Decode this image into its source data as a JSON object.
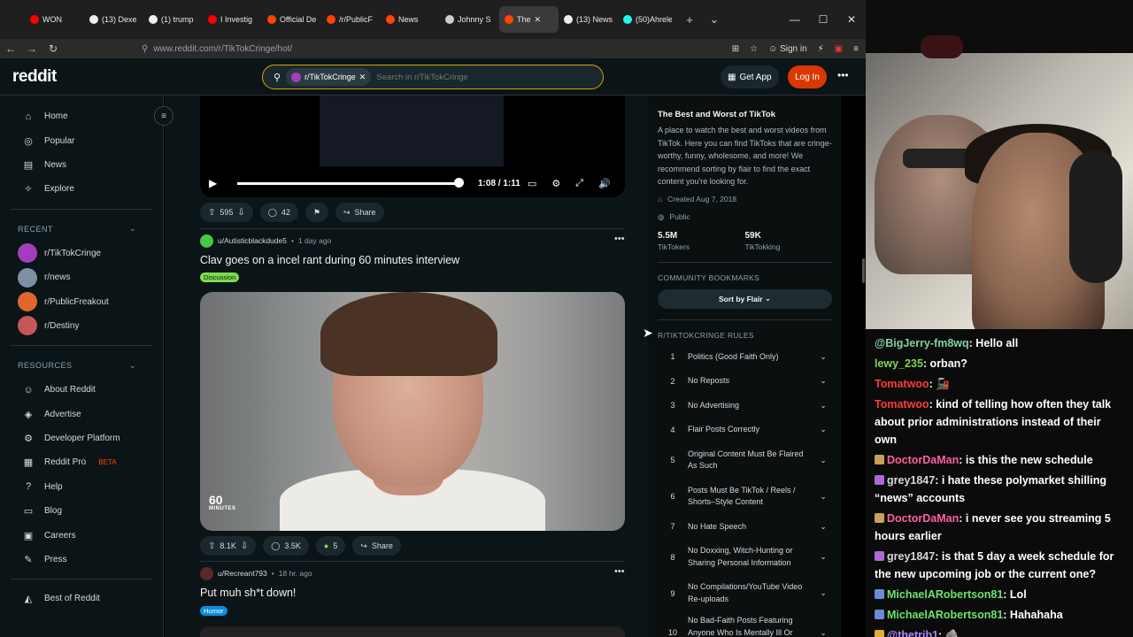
{
  "browser": {
    "tabs": [
      {
        "label": "WON",
        "color": "#ff0000"
      },
      {
        "label": "(13) Dexe",
        "color": "#eeeeee"
      },
      {
        "label": "(1) trump",
        "color": "#eeeeee"
      },
      {
        "label": "I Investig",
        "color": "#ff0000"
      },
      {
        "label": "Official De",
        "color": "#ff4500"
      },
      {
        "label": "/r/PublicF",
        "color": "#ff4500"
      },
      {
        "label": "News",
        "color": "#ff4500"
      },
      {
        "label": "Johnny S",
        "color": "#cccccc"
      },
      {
        "label": "The",
        "color": "#ff4500"
      },
      {
        "label": "(13) News",
        "color": "#eeeeee"
      },
      {
        "label": "(50)Ahrele",
        "color": "#25f4ee"
      }
    ],
    "url": "www.reddit.com/r/TikTokCringe/hot/",
    "sign_in": "Sign in"
  },
  "header": {
    "logo": "reddit",
    "search_chip": "r/TikTokCringe",
    "search_placeholder": "Search in r/TikTokCringe",
    "get_app": "Get App",
    "log_in": "Log In"
  },
  "sidebar": {
    "main_items": [
      {
        "label": "Home",
        "icon": "⌂"
      },
      {
        "label": "Popular",
        "icon": "◎"
      },
      {
        "label": "News",
        "icon": "▤"
      },
      {
        "label": "Explore",
        "icon": "✧"
      }
    ],
    "recent_label": "RECENT",
    "recent": [
      {
        "label": "r/TikTokCringe",
        "color": "#a33dbd"
      },
      {
        "label": "r/news",
        "color": "#7c8fa3"
      },
      {
        "label": "r/PublicFreakout",
        "color": "#e2662b"
      },
      {
        "label": "r/Destiny",
        "color": "#c45858"
      }
    ],
    "resources_label": "RESOURCES",
    "resources": [
      {
        "label": "About Reddit",
        "icon": "☺"
      },
      {
        "label": "Advertise",
        "icon": "◈"
      },
      {
        "label": "Developer Platform",
        "icon": "⚙"
      },
      {
        "label": "Reddit Pro",
        "icon": "▦",
        "badge": "BETA"
      },
      {
        "label": "Help",
        "icon": "?"
      },
      {
        "label": "Blog",
        "icon": "▭"
      },
      {
        "label": "Careers",
        "icon": "▣"
      },
      {
        "label": "Press",
        "icon": "✎"
      }
    ],
    "best_of": "Best of Reddit"
  },
  "feed": {
    "player": {
      "time": "1:08 / 1:11",
      "progress": 0.96
    },
    "post1_actions": {
      "votes": "595",
      "comments": "42",
      "share": "Share"
    },
    "post2": {
      "author": "u/Autisticblackdude5",
      "ago": "1 day ago",
      "title": "Clav goes on a incel rant during 60 minutes interview",
      "flair": "Discussion",
      "media_logo_top": "60",
      "media_logo_bottom": "MINUTES",
      "votes": "8.1K",
      "comments": "3.5K",
      "awards": "5",
      "share": "Share"
    },
    "post3": {
      "author": "u/Recreant793",
      "ago": "18 hr. ago",
      "title": "Put muh sh*t down!",
      "flair": "Humor"
    }
  },
  "community": {
    "title": "The Best and Worst of TikTok",
    "description": "A place to watch the best and worst videos from TikTok. Here you can find TikToks that are cringe-worthy, funny, wholesome, and more! We recommend sorting by flair to find the exact content you're looking for.",
    "created": "Created Aug 7, 2018",
    "visibility": "Public",
    "members": "5.5M",
    "members_label": "TikTokers",
    "online": "59K",
    "online_label": "TikTokking",
    "bookmarks_label": "COMMUNITY BOOKMARKS",
    "sort_by_flair": "Sort by Flair",
    "rules_label": "R/TIKTOKCRINGE RULES",
    "rules": [
      {
        "n": "1",
        "text": "Politics (Good Faith Only)"
      },
      {
        "n": "2",
        "text": "No Reposts"
      },
      {
        "n": "3",
        "text": "No Advertising"
      },
      {
        "n": "4",
        "text": "Flair Posts Correctly"
      },
      {
        "n": "5",
        "text": "Original Content Must Be Flaired As Such"
      },
      {
        "n": "6",
        "text": "Posts Must Be TikTok / Reels / Shorts–Style Content"
      },
      {
        "n": "7",
        "text": "No Hate Speech"
      },
      {
        "n": "8",
        "text": "No Doxxing, Witch-Hunting or Sharing Personal Information"
      },
      {
        "n": "9",
        "text": "No Compilations/YouTube Video Re-uploads"
      },
      {
        "n": "10",
        "text": "No Bad-Faith Posts Featuring Anyone Who Is Mentally Ill Or Disabled"
      }
    ]
  },
  "chat": [
    {
      "user": "@BigJerry-fm8wq",
      "color": "#7fd3a0",
      "text": ": Hello all",
      "badge": ""
    },
    {
      "user": "lewy_235",
      "color": "#7fd35a",
      "text": ": orban?",
      "badge": ""
    },
    {
      "user": "Tomatwoo",
      "color": "#ff3b3b",
      "text": ": 🚂",
      "badge": ""
    },
    {
      "user": "Tomatwoo",
      "color": "#ff3b3b",
      "text": ": kind of telling how often they talk about prior administrations instead of their own",
      "badge": ""
    },
    {
      "user": "DoctorDaMan",
      "color": "#ff5fa0",
      "text": ": is this the new schedule",
      "badge": "#c9a15a"
    },
    {
      "user": "grey1847",
      "color": "#d8d8d8",
      "text": ": i hate these polymarket shilling “news” accounts",
      "badge": "#b067d6"
    },
    {
      "user": "DoctorDaMan",
      "color": "#ff5fa0",
      "text": ": i never see you streaming 5 hours earlier",
      "badge": "#c9a15a"
    },
    {
      "user": "grey1847",
      "color": "#d8d8d8",
      "text": ": is that 5 day a week schedule for the new upcoming job or the current one?",
      "badge": "#b067d6"
    },
    {
      "user": "MichaelARobertson81",
      "color": "#6be36b",
      "text": ": Lol",
      "badge": "#6a8cd6"
    },
    {
      "user": "MichaelARobertson81",
      "color": "#6be36b",
      "text": ": Hahahaha",
      "badge": "#6a8cd6"
    },
    {
      "user": "@thetrib1",
      "color": "#b189ff",
      "text": ": 🪨",
      "badge": "#e0b030"
    }
  ]
}
